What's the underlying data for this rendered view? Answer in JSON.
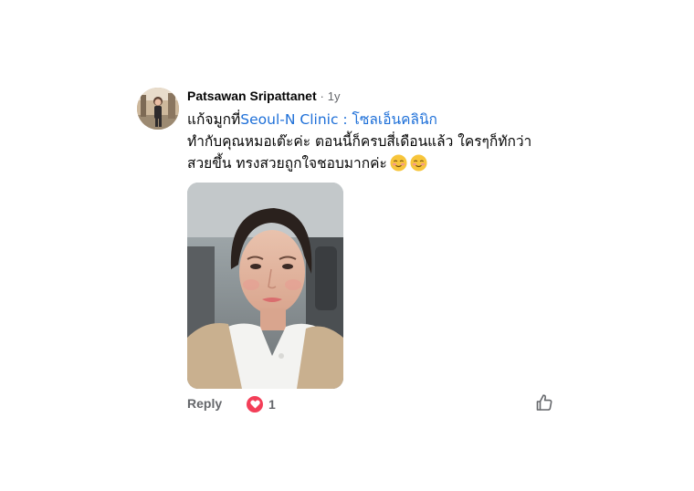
{
  "comment": {
    "author": "Patsawan Sripattanet",
    "separator": "·",
    "time": "1y",
    "text_prefix": "แก้จมูกที่",
    "mention": "Seoul-N Clinic : โซลเอ็นคลินิก",
    "text_line_2": "ทำกับคุณหมอเต๊ะค่ะ  ตอนนี้ก็ครบสี่เดือนแล้ว ใครๆก็ทักว่า",
    "text_line_3": "สวยขึ้น ทรงสวยถูกใจชอบมากค่ะ",
    "emoji": "smiling-face-icon",
    "emoji_count": 2,
    "mention_color": "#1d6fd8"
  },
  "actions": {
    "reply_label": "Reply",
    "reaction_icon": "heart-icon",
    "reaction_count": "1",
    "reaction_color": "#f33e58",
    "like_icon": "thumbs-up-icon"
  }
}
